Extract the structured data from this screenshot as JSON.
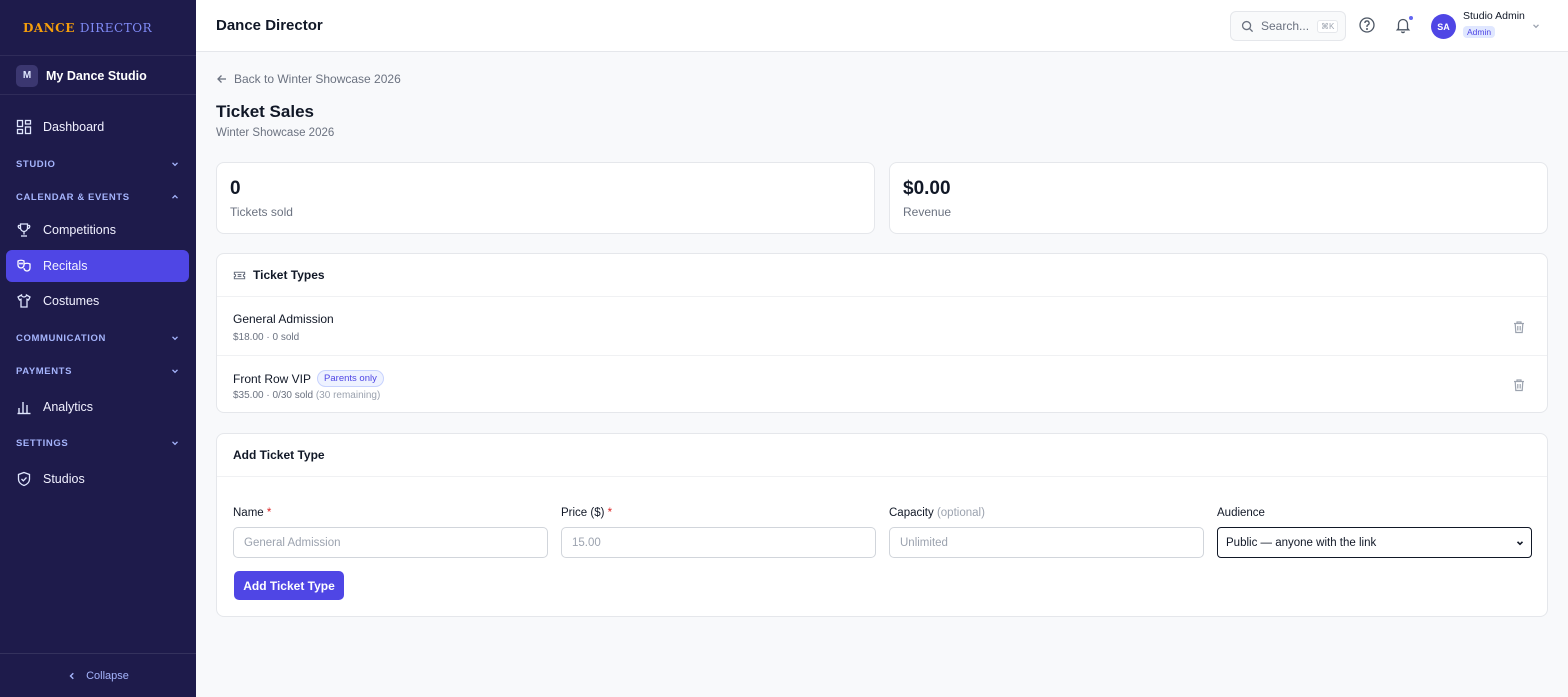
{
  "brand": {
    "part1": "DANCE",
    "part2": "DIRECTOR",
    "accent": "#f59e0b",
    "secondary": "#818cf8"
  },
  "studio": {
    "initial": "M",
    "name": "My Dance Studio"
  },
  "sidebar": {
    "dashboard": "Dashboard",
    "sections": {
      "studio": "STUDIO",
      "calendar": "CALENDAR & EVENTS",
      "communication": "COMMUNICATION",
      "payments": "PAYMENTS",
      "settings": "SETTINGS"
    },
    "items": {
      "competitions": "Competitions",
      "recitals": "Recitals",
      "costumes": "Costumes",
      "analytics": "Analytics",
      "studios": "Studios"
    },
    "collapse": "Collapse",
    "bg": "#1e1b4b",
    "active_color": "#4f46e5"
  },
  "header": {
    "title": "Dance Director",
    "search_placeholder": "Search...",
    "search_shortcut": "⌘K",
    "user_initials": "SA",
    "user_name": "Studio Admin",
    "user_role": "Admin"
  },
  "page": {
    "back_link": "Back to Winter Showcase 2026",
    "title": "Ticket Sales",
    "subtitle": "Winter Showcase 2026"
  },
  "stats": {
    "tickets_sold_value": "0",
    "tickets_sold_label": "Tickets sold",
    "revenue_value": "$0.00",
    "revenue_label": "Revenue"
  },
  "ticket_types": {
    "heading": "Ticket Types",
    "items": [
      {
        "name": "General Admission",
        "meta": "$18.00 · 0 sold",
        "remaining": ""
      },
      {
        "name": "Front Row VIP",
        "badge": "Parents only",
        "meta": "$35.00 · 0/30 sold",
        "remaining": "(30 remaining)"
      }
    ]
  },
  "add_form": {
    "heading": "Add Ticket Type",
    "name_label": "Name",
    "name_placeholder": "General Admission",
    "price_label": "Price ($)",
    "price_placeholder": "15.00",
    "capacity_label": "Capacity",
    "capacity_optional": "(optional)",
    "capacity_placeholder": "Unlimited",
    "audience_label": "Audience",
    "audience_value": "Public — anyone with the link",
    "required_marker": "*",
    "submit": "Add Ticket Type"
  }
}
